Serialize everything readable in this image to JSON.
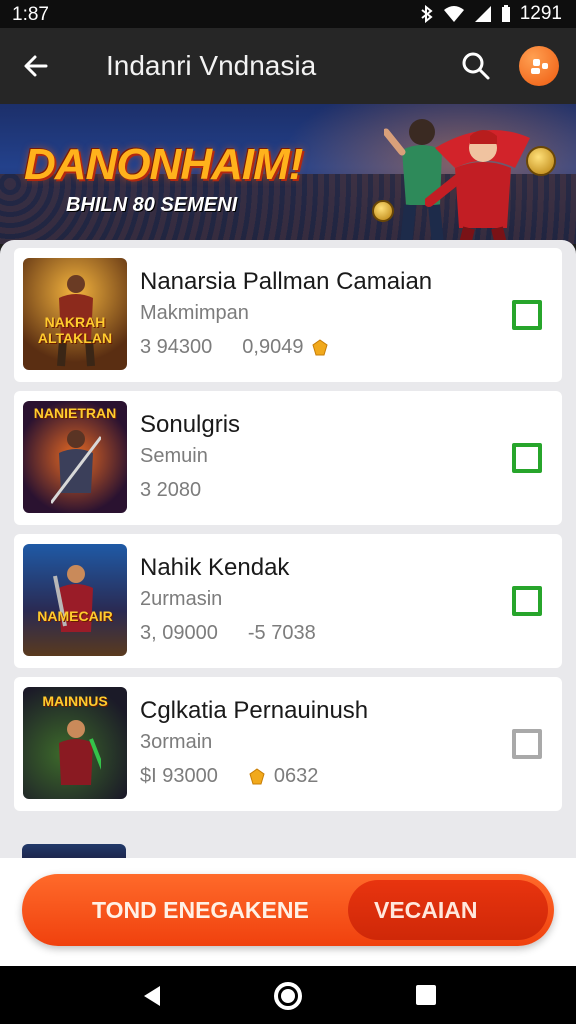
{
  "status_bar": {
    "time": "1:87",
    "clock": "1291"
  },
  "app_bar": {
    "title": "Indanri Vndnasia"
  },
  "banner": {
    "title": "DANONHAIM!",
    "subtitle": "BHILN 80 SEMENI"
  },
  "items": [
    {
      "title": "Nanarsia Pallman Camaian",
      "subtitle": "Makmimpan",
      "stat1": "3  94300",
      "stat2": "0,9049",
      "checked": true,
      "thumb_label": "NAKRAH ALTAKLAN"
    },
    {
      "title": "Sonulgris",
      "subtitle": "Semuin",
      "stat1": "3  2080",
      "stat2": "",
      "checked": true,
      "thumb_label": "NANIETRAN"
    },
    {
      "title": "Nahik Kendak",
      "subtitle": "2urmasin",
      "stat1": "3, 09000",
      "stat2": "-5 7038",
      "checked": true,
      "thumb_label": "NAMECAIR"
    },
    {
      "title": "Cglkatia Pernauinush",
      "subtitle": "3ormain",
      "stat1": "$I 93000",
      "stat2": "0632",
      "checked": false,
      "thumb_label": "MAINNUS"
    }
  ],
  "cta": {
    "left_label": "TOND ENEGAKENE",
    "right_label": "VECAIAN"
  },
  "colors": {
    "accent": "#f0410e",
    "check": "#27a52b",
    "app_bar": "#262626"
  },
  "icons": {
    "back": "arrow-left-icon",
    "search": "search-icon",
    "avatar": "avatar-icon",
    "gem": "gem-icon"
  }
}
